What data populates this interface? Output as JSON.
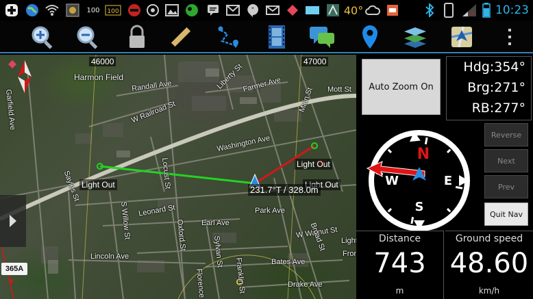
{
  "status_bar": {
    "icons": [
      "plus-icon",
      "globe-icon",
      "wifi-icon",
      "photo-icon",
      "score-100-icon",
      "score-100-box-icon",
      "app-icon",
      "sync-icon",
      "image-icon",
      "chat-app-icon",
      "message-icon",
      "gmail-icon",
      "hangouts-icon",
      "email-icon",
      "diamond-icon",
      "battery-card-icon",
      "maps-icon",
      "weather-temp",
      "cloud-icon",
      "app-tile-icon",
      "bluetooth-icon",
      "phone-icon",
      "signal-icon",
      "battery-icon"
    ],
    "badge_100": "100",
    "temperature": "40°",
    "time": "10:23"
  },
  "toolbar": {
    "buttons": [
      "zoom-in",
      "zoom-out",
      "lock",
      "ruler",
      "route",
      "film",
      "chat",
      "location-pin",
      "layers",
      "map-app",
      "overflow-menu"
    ]
  },
  "map": {
    "grid_labels": {
      "west": "46000",
      "east": "47000"
    },
    "streets": [
      "Harmon Field",
      "Randall Ave",
      "W Railroad St",
      "Washington Ave",
      "Garfield Ave",
      "Farmer Ave",
      "Mott St",
      "Liberty St",
      "Main St",
      "Locust St",
      "Leonard St",
      "Earl Ave",
      "Park Ave",
      "W Walnut St",
      "Lincoln Ave",
      "Bates Ave",
      "Drake Ave",
      "Sayles St",
      "S Willow St",
      "Oxford St",
      "Sylvan St",
      "Franklin St",
      "Florence",
      "Broad St",
      "Front",
      "Light Ma"
    ],
    "waypoint_labels": [
      "Light Out",
      "Light Out",
      "Light Out"
    ],
    "bearing_readout": "231.7°T / 328.0m",
    "route_shield": "365A",
    "colors": {
      "green_leg": "#22d422",
      "red_leg": "#d01818",
      "road_major": "#cfcfc0"
    }
  },
  "nav_panel": {
    "auto_zoom_label": "Auto Zoom On",
    "hdg": "Hdg:354°",
    "brg": "Brg:271°",
    "rb": "RB:277°",
    "compass": {
      "n": "N",
      "e": "E",
      "s": "S",
      "w": "W"
    },
    "buttons": {
      "reverse": "Reverse",
      "next": "Next",
      "prev": "Prev",
      "quit": "Quit Nav"
    },
    "distance": {
      "title": "Distance",
      "value": "743",
      "unit": "m"
    },
    "ground_speed": {
      "title": "Ground speed",
      "value": "48.60",
      "unit": "km/h"
    }
  }
}
